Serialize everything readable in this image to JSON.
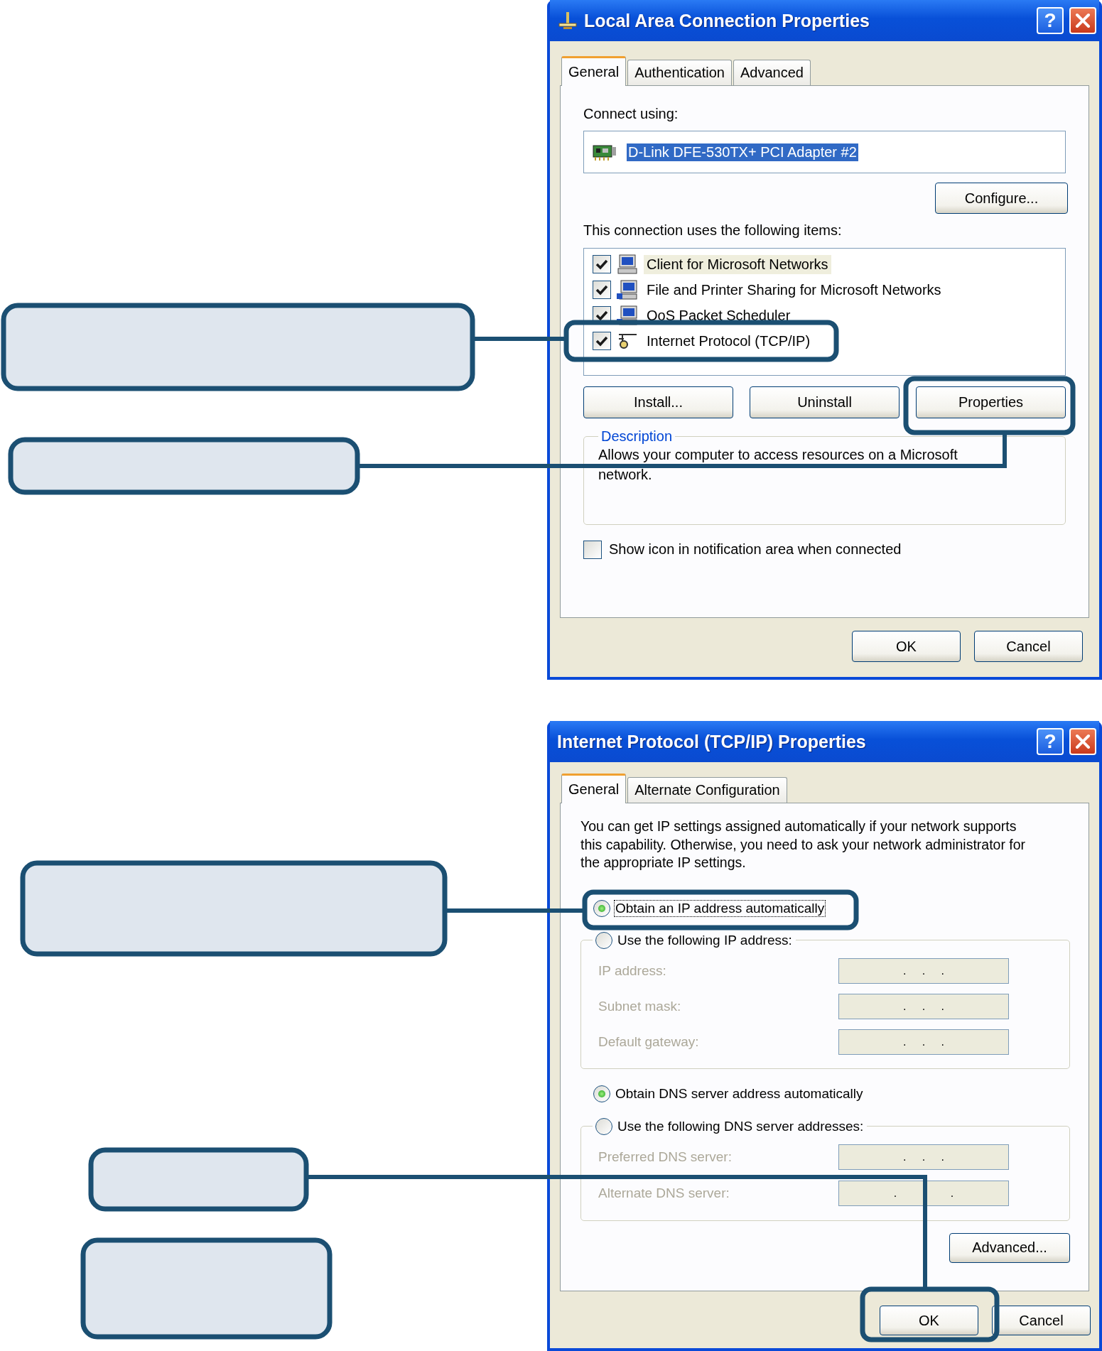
{
  "connection_dialog": {
    "title": "Local Area Connection Properties",
    "help_glyph": "?",
    "tabs": [
      {
        "label": "General",
        "selected": true
      },
      {
        "label": "Authentication",
        "selected": false
      },
      {
        "label": "Advanced",
        "selected": false
      }
    ],
    "connect_using_label": "Connect using:",
    "adapter": {
      "name": "D-Link DFE-530TX+ PCI Adapter #2",
      "selected": true
    },
    "configure_button": "Configure...",
    "items_label": "This connection uses the following items:",
    "items": [
      {
        "kind": "client",
        "label": "Client for Microsoft Networks",
        "checked": true,
        "selected": true
      },
      {
        "kind": "service",
        "label": "File and Printer Sharing for Microsoft Networks",
        "checked": true,
        "selected": false
      },
      {
        "kind": "service",
        "label": "QoS Packet Scheduler",
        "checked": true,
        "selected": false
      },
      {
        "kind": "protocol",
        "label": "Internet Protocol (TCP/IP)",
        "checked": true,
        "selected": false
      }
    ],
    "item_buttons": [
      "Install...",
      "Uninstall",
      "Properties"
    ],
    "description": {
      "legend": "Description",
      "text": "Allows your computer to access resources on a Microsoft network."
    },
    "notify_checkbox": {
      "label": "Show icon in notification area when connected",
      "checked": false
    },
    "buttons": [
      "OK",
      "Cancel"
    ]
  },
  "tcpip_dialog": {
    "title": "Internet Protocol (TCP/IP) Properties",
    "help_glyph": "?",
    "tabs": [
      {
        "label": "General",
        "selected": true
      },
      {
        "label": "Alternate Configuration",
        "selected": false
      }
    ],
    "intro": "You can get IP settings assigned automatically if your network supports this capability. Otherwise, you need to ask your network administrator for the appropriate IP settings.",
    "ip_options": [
      {
        "label": "Obtain an IP address automatically",
        "selected": true,
        "focused": true
      },
      {
        "label": "Use the following IP address:",
        "selected": false,
        "focused": false
      }
    ],
    "ip_fields": {
      "disabled": true,
      "fields": [
        {
          "label": "IP address:",
          "value": ".     .     ."
        },
        {
          "label": "Subnet mask:",
          "value": ".     .     ."
        },
        {
          "label": "Default gateway:",
          "value": ".     .     ."
        }
      ]
    },
    "dns_options": [
      {
        "label": "Obtain DNS server address automatically",
        "selected": true,
        "focused": false
      },
      {
        "label": "Use the following DNS server addresses:",
        "selected": false,
        "focused": false
      }
    ],
    "dns_fields": {
      "disabled": true,
      "fields": [
        {
          "label": "Preferred DNS server:",
          "value": ".     .     ."
        },
        {
          "label": "Alternate DNS server:",
          "value": ".                 ."
        }
      ]
    },
    "advanced_button": "Advanced...",
    "buttons": [
      "OK",
      "Cancel"
    ]
  }
}
